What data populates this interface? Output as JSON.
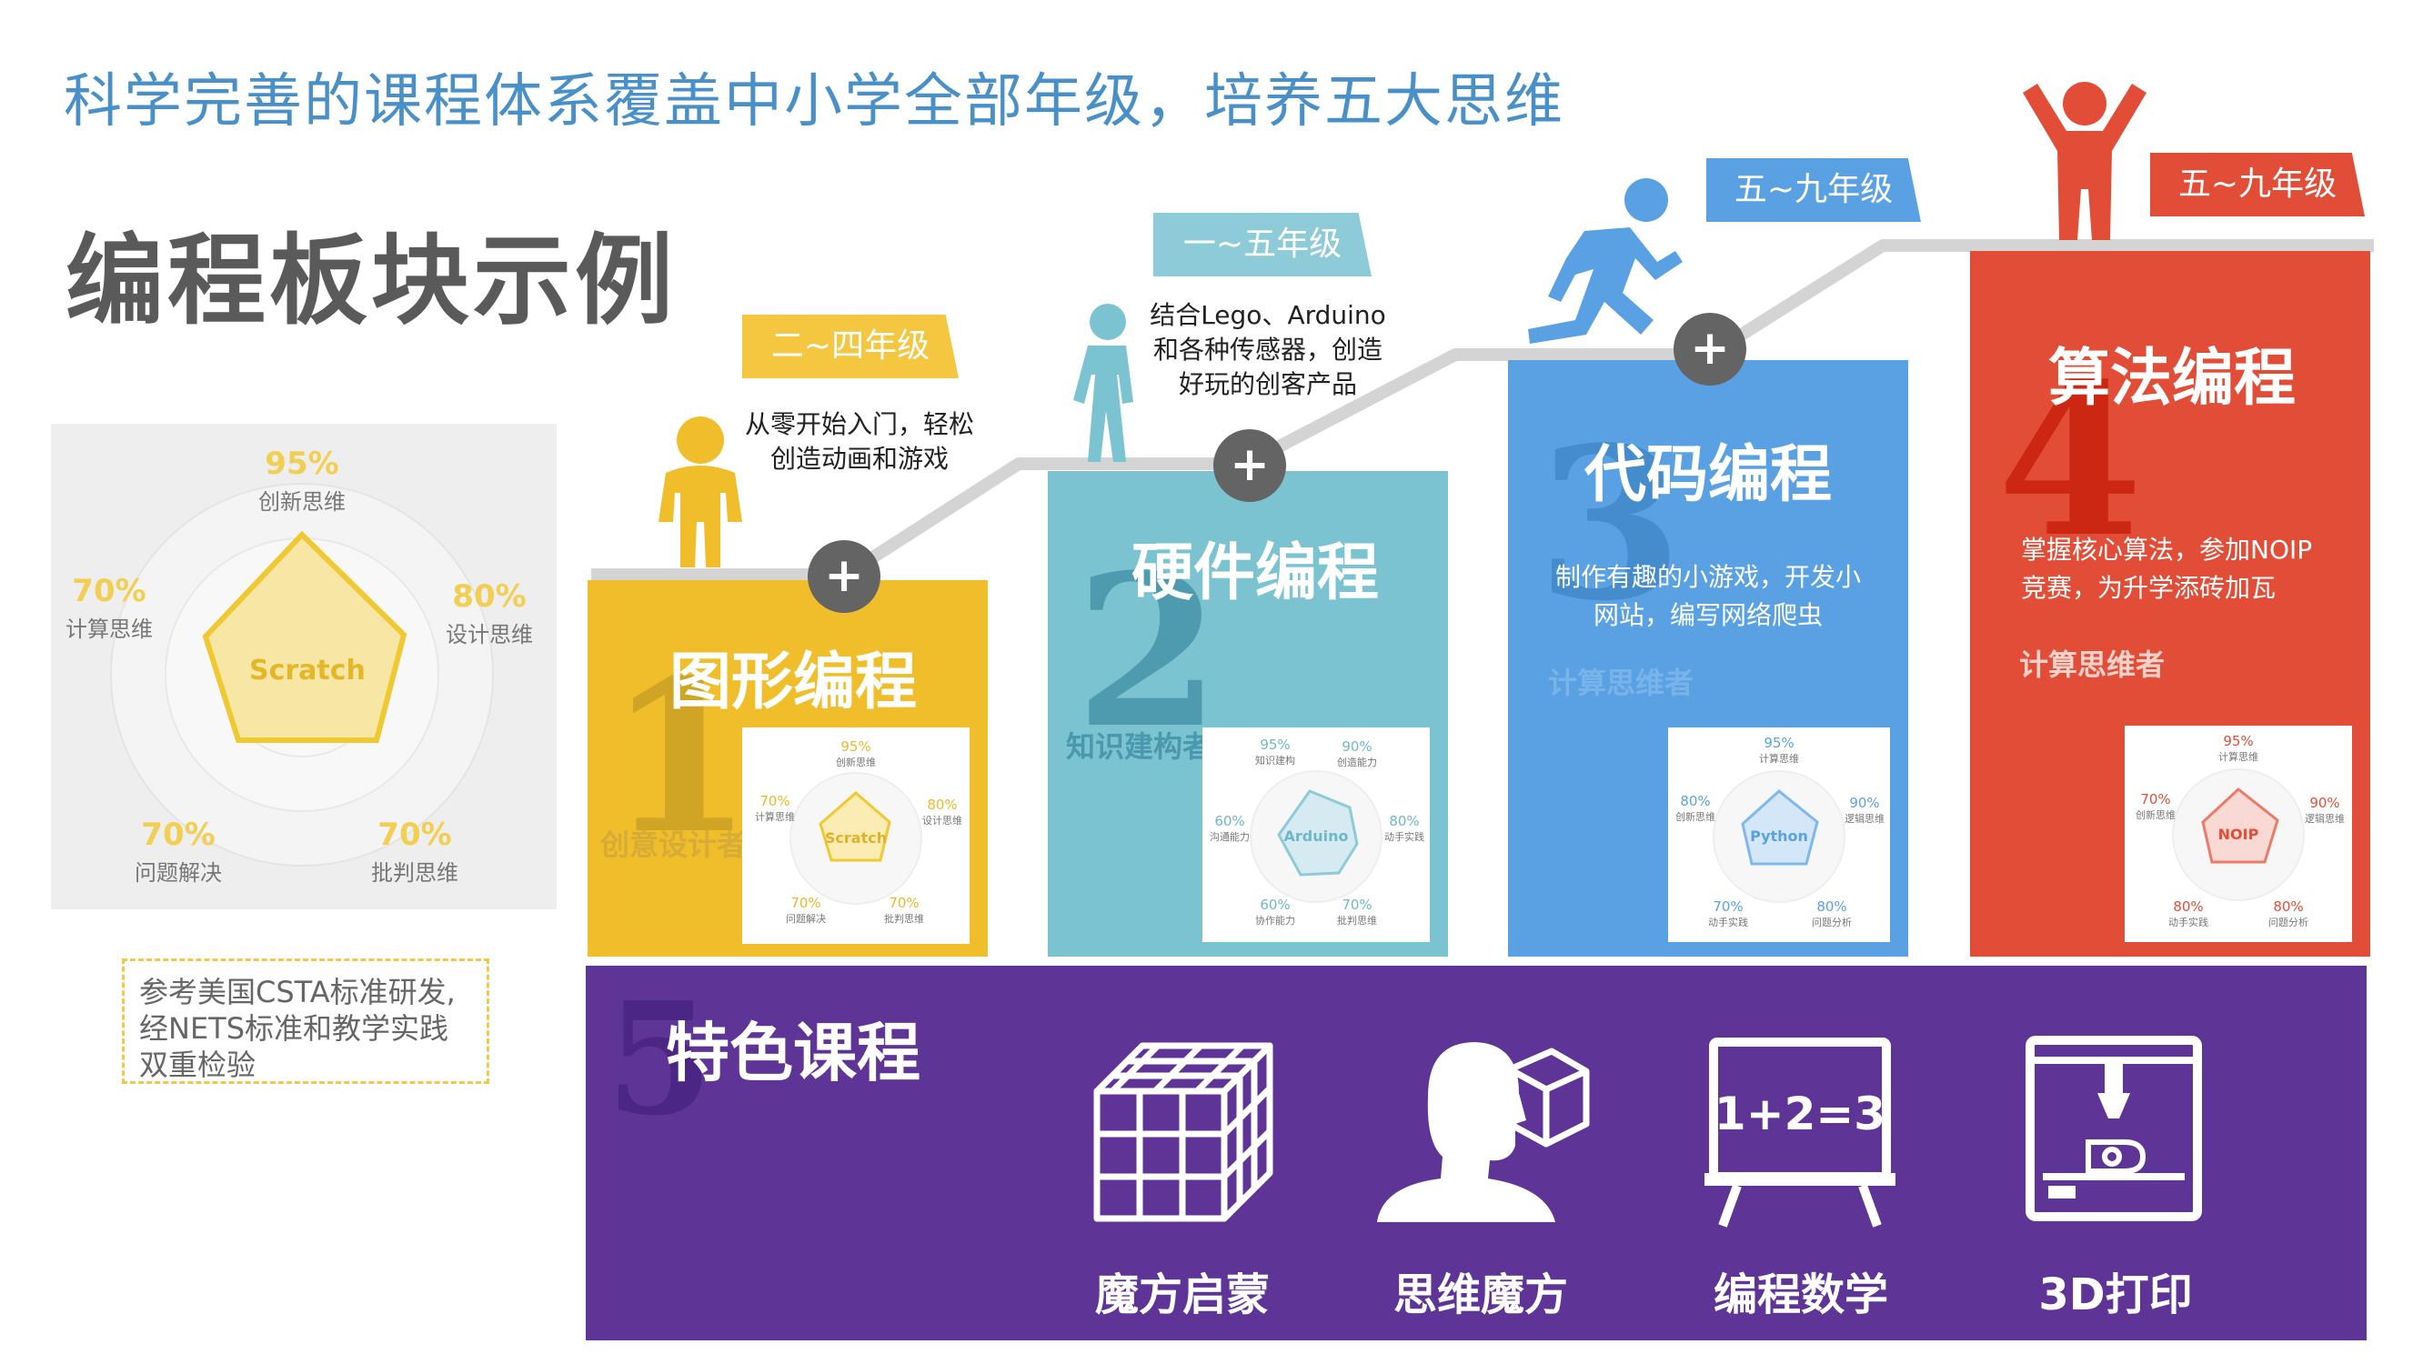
{
  "headline": "科学完善的课程体系覆盖中小学全部年级，培养五大思维",
  "section_title": "编程板块示例",
  "radar_main": {
    "center": "Scratch",
    "axes": [
      {
        "pct": "95%",
        "label": "创新思维"
      },
      {
        "pct": "80%",
        "label": "设计思维"
      },
      {
        "pct": "70%",
        "label": "批判思维"
      },
      {
        "pct": "70%",
        "label": "问题解决"
      },
      {
        "pct": "70%",
        "label": "计算思维"
      }
    ]
  },
  "reference_note": "参考美国CSTA标准研发,经NETS标准和教学实践双重检验",
  "steps": [
    {
      "number": "1",
      "title": "图形编程",
      "role": "创意设计者",
      "grade": "二~四年级",
      "bubble": "从零开始入门，轻松创造动画和游戏",
      "color": "#f0bd2b",
      "radar": {
        "center": "Scratch",
        "axes": [
          {
            "pct": "95%",
            "label": "创新思维"
          },
          {
            "pct": "80%",
            "label": "设计思维"
          },
          {
            "pct": "70%",
            "label": "批判思维"
          },
          {
            "pct": "70%",
            "label": "问题解决"
          },
          {
            "pct": "70%",
            "label": "计算思维"
          }
        ]
      }
    },
    {
      "number": "2",
      "title": "硬件编程",
      "role": "知识建构者",
      "grade": "一~五年级",
      "bubble": "结合Lego、Arduino和各种传感器，创造好玩的创客产品",
      "color": "#7cc3d2",
      "radar": {
        "center": "Arduino",
        "axes": [
          {
            "pct": "95%",
            "label": "知识建构"
          },
          {
            "pct": "90%",
            "label": "创造能力"
          },
          {
            "pct": "80%",
            "label": "动手实践"
          },
          {
            "pct": "70%",
            "label": "批判思维"
          },
          {
            "pct": "60%",
            "label": "协作能力"
          },
          {
            "pct": "60%",
            "label": "沟通能力"
          }
        ]
      }
    },
    {
      "number": "3",
      "title": "代码编程",
      "role": "计算思维者",
      "grade": "五~九年级",
      "bubble": "",
      "desc": "制作有趣的小游戏，开发小网站，编写网络爬虫",
      "color": "#5aa1e3",
      "radar": {
        "center": "Python",
        "axes": [
          {
            "pct": "95%",
            "label": "计算思维"
          },
          {
            "pct": "90%",
            "label": "逻辑思维"
          },
          {
            "pct": "80%",
            "label": "问题分析"
          },
          {
            "pct": "70%",
            "label": "动手实践"
          },
          {
            "pct": "80%",
            "label": "创新思维"
          }
        ]
      }
    },
    {
      "number": "4",
      "title": "算法编程",
      "role": "计算思维者",
      "grade": "五~九年级",
      "bubble": "",
      "desc": "掌握核心算法，参加NOIP竞赛，为升学添砖加瓦",
      "color": "#e24d37",
      "radar": {
        "center": "NOIP",
        "axes": [
          {
            "pct": "95%",
            "label": "计算思维"
          },
          {
            "pct": "90%",
            "label": "逻辑思维"
          },
          {
            "pct": "80%",
            "label": "问题分析"
          },
          {
            "pct": "80%",
            "label": "动手实践"
          },
          {
            "pct": "70%",
            "label": "创新思维"
          }
        ]
      }
    }
  ],
  "featured": {
    "number": "5",
    "title": "特色课程",
    "items": [
      {
        "label": "魔方启蒙",
        "icon": "rubiks-cube-icon"
      },
      {
        "label": "思维魔方",
        "icon": "thinker-head-icon"
      },
      {
        "label": "编程数学",
        "icon": "math-board-icon",
        "board_text": "1+2=3"
      },
      {
        "label": "3D打印",
        "icon": "3d-printer-icon"
      }
    ]
  },
  "colors": {
    "headline": "#4a90c8",
    "yellow": "#f0bd2b",
    "teal": "#7cc3d2",
    "blue": "#5aa1e3",
    "red": "#e24d37",
    "purple": "#5e3497",
    "grey": "#646464"
  }
}
